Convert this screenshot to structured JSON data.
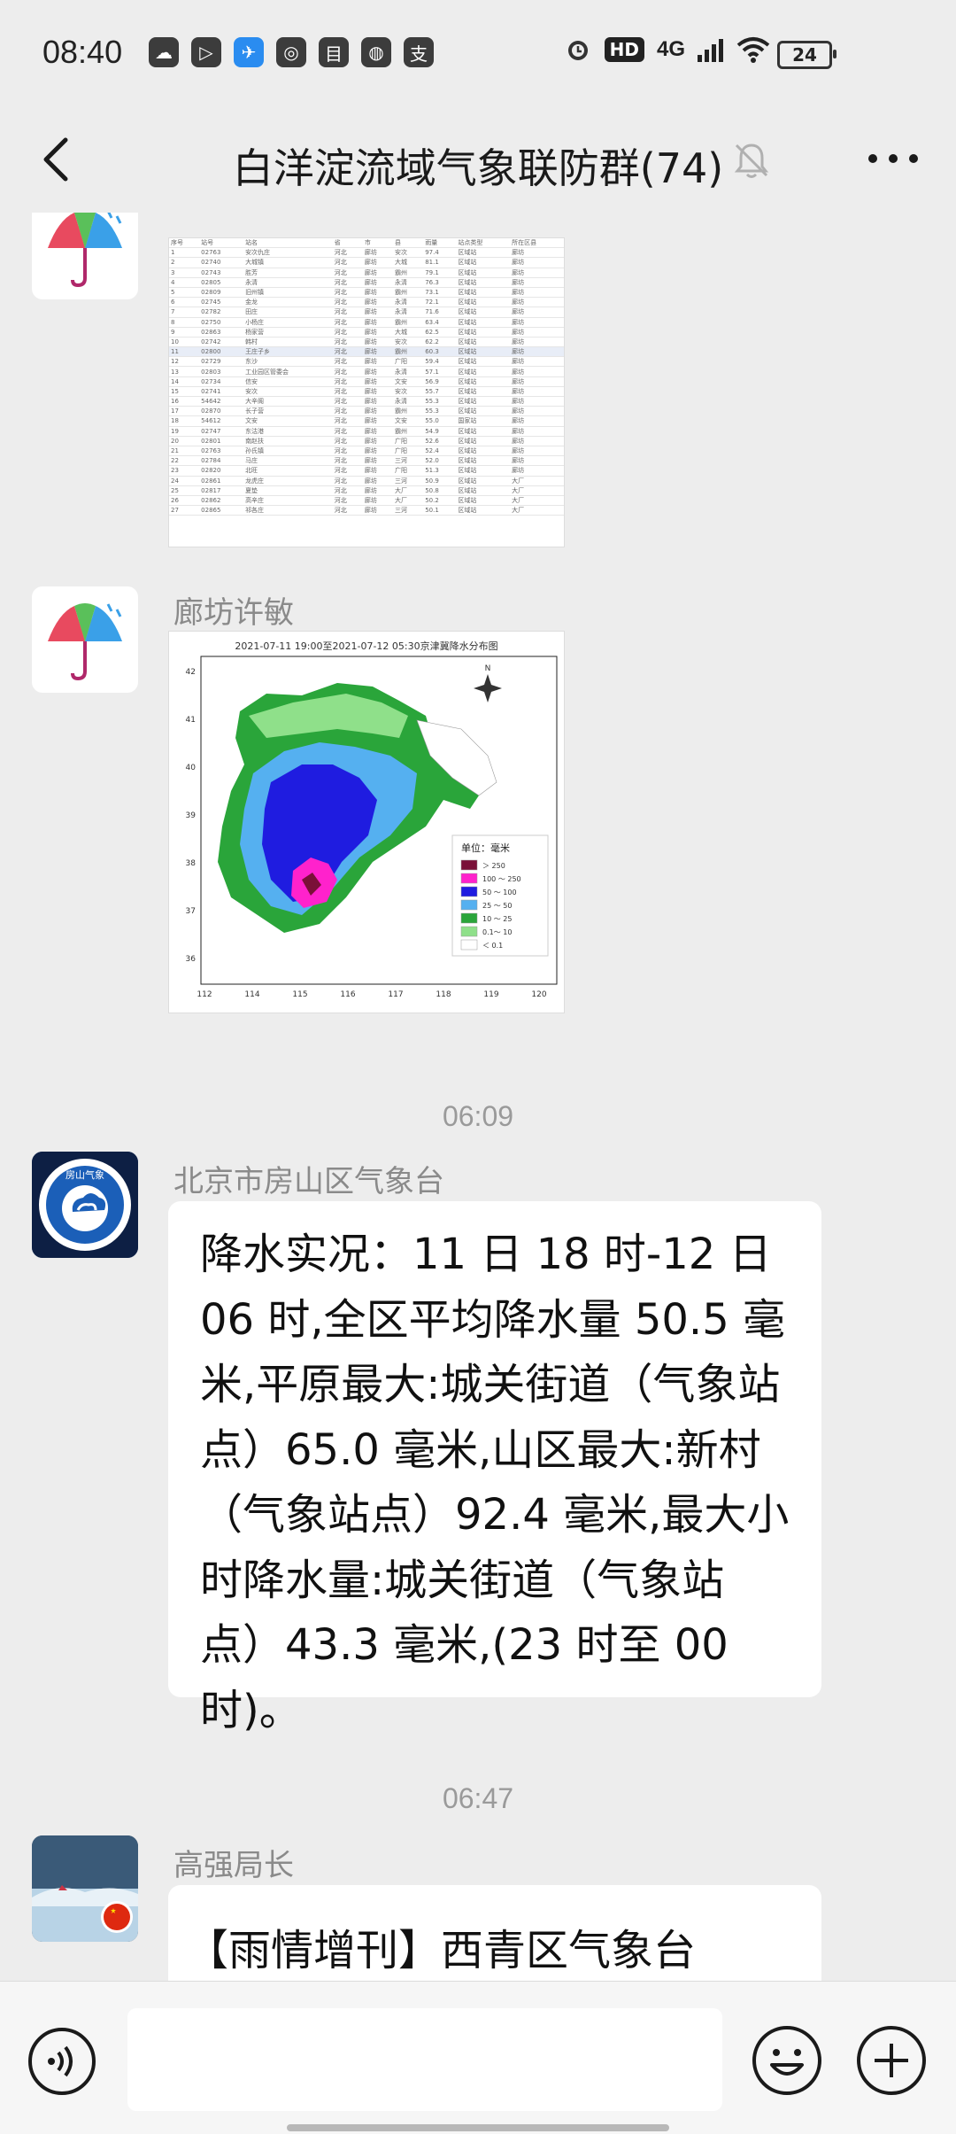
{
  "status_bar": {
    "time": "08:40",
    "network": "4G",
    "hd": "HD",
    "battery": "24",
    "left_icons": [
      "wechat-icon",
      "play-icon",
      "telegram-icon",
      "app-icon",
      "doc-icon",
      "chat-icon",
      "alipay-icon"
    ],
    "left_glyphs": [
      "☁",
      "▷",
      "✈",
      "◎",
      "目",
      "◍",
      "支"
    ]
  },
  "header": {
    "title": "白洋淀流域气象联防群(74)"
  },
  "messages": [
    {
      "sender": "",
      "type": "table-image",
      "table_rows": [
        [
          "序号",
          "站号",
          "站名",
          "省",
          "市",
          "县",
          "雨量",
          "站点类型",
          "所在区县"
        ],
        [
          "1",
          "02763",
          "安次仇庄",
          "河北",
          "廊坊",
          "安次",
          "97.4",
          "区域站",
          "廊坊"
        ],
        [
          "2",
          "02740",
          "大城镇",
          "河北",
          "廊坊",
          "大城",
          "81.1",
          "区域站",
          "廊坊"
        ],
        [
          "3",
          "02743",
          "胜芳",
          "河北",
          "廊坊",
          "霸州",
          "79.1",
          "区域站",
          "廊坊"
        ],
        [
          "4",
          "02805",
          "永清",
          "河北",
          "廊坊",
          "永清",
          "76.3",
          "区域站",
          "廊坊"
        ],
        [
          "5",
          "02809",
          "旧州镇",
          "河北",
          "廊坊",
          "霸州",
          "73.1",
          "区域站",
          "廊坊"
        ],
        [
          "6",
          "02745",
          "金龙",
          "河北",
          "廊坊",
          "永清",
          "72.1",
          "区域站",
          "廊坊"
        ],
        [
          "7",
          "02782",
          "田庄",
          "河北",
          "廊坊",
          "永清",
          "71.6",
          "区域站",
          "廊坊"
        ],
        [
          "8",
          "02750",
          "小杨庄",
          "河北",
          "廊坊",
          "霸州",
          "63.4",
          "区域站",
          "廊坊"
        ],
        [
          "9",
          "02863",
          "杨家营",
          "河北",
          "廊坊",
          "大城",
          "62.5",
          "区域站",
          "廊坊"
        ],
        [
          "10",
          "02742",
          "韩村",
          "河北",
          "廊坊",
          "安次",
          "62.2",
          "区域站",
          "廊坊"
        ],
        [
          "11",
          "02800",
          "王庄子乡",
          "河北",
          "廊坊",
          "霸州",
          "60.3",
          "区域站",
          "廊坊"
        ],
        [
          "12",
          "02729",
          "东沙",
          "河北",
          "廊坊",
          "广阳",
          "59.4",
          "区域站",
          "廊坊"
        ],
        [
          "13",
          "02803",
          "工业园区管委会",
          "河北",
          "廊坊",
          "永清",
          "57.1",
          "区域站",
          "廊坊"
        ],
        [
          "14",
          "02734",
          "信安",
          "河北",
          "廊坊",
          "文安",
          "56.9",
          "区域站",
          "廊坊"
        ],
        [
          "15",
          "02741",
          "安次",
          "河北",
          "廊坊",
          "安次",
          "55.7",
          "区域站",
          "廊坊"
        ],
        [
          "16",
          "54642",
          "大辛阁",
          "河北",
          "廊坊",
          "永清",
          "55.3",
          "区域站",
          "廊坊"
        ],
        [
          "17",
          "02870",
          "长子营",
          "河北",
          "廊坊",
          "霸州",
          "55.3",
          "区域站",
          "廊坊"
        ],
        [
          "18",
          "54612",
          "文安",
          "河北",
          "廊坊",
          "文安",
          "55.0",
          "国家站",
          "廊坊"
        ],
        [
          "19",
          "02747",
          "东沽港",
          "河北",
          "廊坊",
          "霸州",
          "54.9",
          "区域站",
          "廊坊"
        ],
        [
          "20",
          "02801",
          "南赵扶",
          "河北",
          "廊坊",
          "广阳",
          "52.6",
          "区域站",
          "廊坊"
        ],
        [
          "21",
          "02763",
          "孙氏镇",
          "河北",
          "廊坊",
          "广阳",
          "52.4",
          "区域站",
          "廊坊"
        ],
        [
          "22",
          "02784",
          "马庄",
          "河北",
          "廊坊",
          "三河",
          "52.0",
          "区域站",
          "廊坊"
        ],
        [
          "23",
          "02820",
          "北旺",
          "河北",
          "廊坊",
          "广阳",
          "51.3",
          "区域站",
          "廊坊"
        ],
        [
          "24",
          "02861",
          "龙虎庄",
          "河北",
          "廊坊",
          "三河",
          "50.9",
          "区域站",
          "大厂"
        ],
        [
          "25",
          "02817",
          "夏垫",
          "河北",
          "廊坊",
          "大厂",
          "50.8",
          "区域站",
          "大厂"
        ],
        [
          "26",
          "02862",
          "高辛庄",
          "河北",
          "廊坊",
          "大厂",
          "50.2",
          "区域站",
          "大厂"
        ],
        [
          "27",
          "02865",
          "祁各庄",
          "河北",
          "廊坊",
          "三河",
          "50.1",
          "区域站",
          "大厂"
        ]
      ]
    },
    {
      "sender": "廊坊许敏",
      "type": "map-image",
      "map": {
        "title": "2021-07-11 19:00至2021-07-12 05:30京津冀降水分布图",
        "y_ticks": [
          "42",
          "41",
          "40",
          "39",
          "38",
          "37",
          "36"
        ],
        "x_ticks": [
          "112",
          "114",
          "115",
          "116",
          "117",
          "118",
          "119",
          "120"
        ],
        "legend_title": "单位：毫米",
        "north": "N",
        "legend": [
          {
            "label": "＞ 250",
            "color": "#7a1038"
          },
          {
            "label": "100 ～ 250",
            "color": "#ff22cc"
          },
          {
            "label": "50 ～ 100",
            "color": "#1f1ce0"
          },
          {
            "label": "25 ～ 50",
            "color": "#55b0f0"
          },
          {
            "label": "10 ～ 25",
            "color": "#2aa53a"
          },
          {
            "label": "0.1～ 10",
            "color": "#8fe08a"
          },
          {
            "label": "＜ 0.1",
            "color": "#ffffff"
          }
        ]
      }
    },
    {
      "type": "timestamp",
      "time": "06:09"
    },
    {
      "sender": "北京市房山区气象台",
      "type": "text",
      "lines": [
        "降水实况：11 日 18 时-12 日",
        "06 时,全区平均降水量 50.5 毫",
        "米,平原最大:城关街道（气象站",
        "点）65.0 毫米,山区最大:新村",
        "（气象站点）92.4 毫米,最大小",
        "时降水量:城关街道（气象站",
        "点）43.3 毫米,(23 时至 00 时)。"
      ],
      "avatar_text": "房山气象"
    },
    {
      "type": "timestamp",
      "time": "06:47"
    },
    {
      "sender": "高强局长",
      "type": "text",
      "text": "【雨情增刊】西青区气象台"
    }
  ]
}
